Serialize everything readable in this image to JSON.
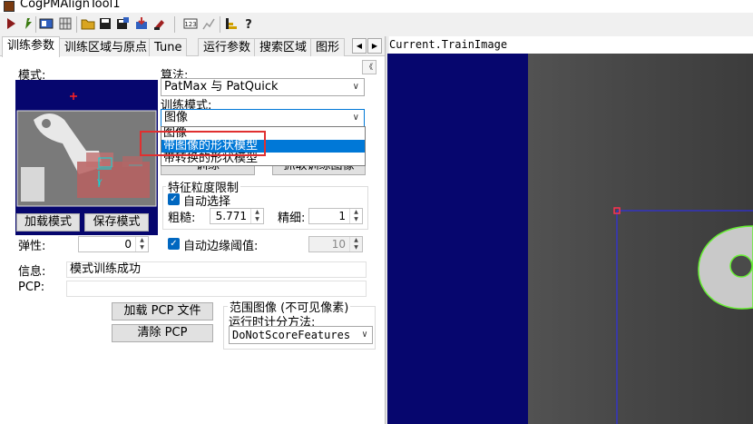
{
  "window": {
    "title": "CogPMAlignTool1"
  },
  "toolbar": {
    "buttons": [
      {
        "icon": "run-icon",
        "color": "#8b1a1a"
      },
      {
        "icon": "electric-icon",
        "color": "#3a7a10"
      },
      {
        "icon": "image-window-icon",
        "color": "#3060c0"
      },
      {
        "icon": "grid-icon",
        "color": "#555555"
      },
      {
        "icon": "open-folder-icon",
        "color": "#d9a520"
      },
      {
        "icon": "save-icon",
        "color": "#202020"
      },
      {
        "icon": "save-as-icon",
        "color": "#202020"
      },
      {
        "icon": "import-icon",
        "color": "#c03030"
      },
      {
        "icon": "reset-icon",
        "color": "#a02020"
      },
      {
        "icon": "calculator-icon",
        "color": "#404040"
      },
      {
        "icon": "chart-disabled-icon",
        "color": "#999999"
      },
      {
        "icon": "record-icon",
        "color": "#d0a000"
      },
      {
        "icon": "help-icon",
        "color": "#202020"
      }
    ]
  },
  "tabs": {
    "items": [
      "训练参数",
      "训练区域与原点",
      "Tune",
      "运行参数",
      "搜索区域",
      "图形"
    ],
    "active": 0,
    "left_arrow": "◀",
    "right_arrow": "▶"
  },
  "panel": {
    "model_label": "模式:",
    "algorithm_label": "算法:",
    "algorithm_value": "PatMax 与 PatQuick",
    "train_mode_label": "训练模式:",
    "train_mode_value": "图像",
    "train_mode_options": [
      "图像",
      "带图像的形状模型",
      "带转换的形状模型"
    ],
    "train_mode_highlighted": 1,
    "train_button": "训练",
    "grab_train_image_button": "抓取训练图像",
    "feature_group_label": "特征粒度限制",
    "auto_select_label": "自动选择",
    "coarse_label": "粗糙:",
    "coarse_value": "5.771",
    "fine_label": "精细:",
    "fine_value": "1",
    "load_model_button": "加载模式",
    "save_model_button": "保存模式",
    "elasticity_label": "弹性:",
    "elasticity_value": "0",
    "auto_edge_label": "自动边缘阈值:",
    "auto_edge_value": "10",
    "info_label": "信息:",
    "info_value": "模式训练成功",
    "pcp_label": "PCP:",
    "pcp_value": "",
    "load_pcp_button": "加载 PCP 文件",
    "clear_pcp_button": "清除 PCP",
    "range_image_label": "范围图像 (不可见像素)",
    "scoring_label": "运行时计分方法:",
    "scoring_value": "DoNotScoreFeatures",
    "collapse_button": "《"
  },
  "image_view": {
    "title": "Current.TrainImage",
    "background_color": "#06066e",
    "contour_color": "#66ee33",
    "roi_color": "#2a2aff"
  }
}
